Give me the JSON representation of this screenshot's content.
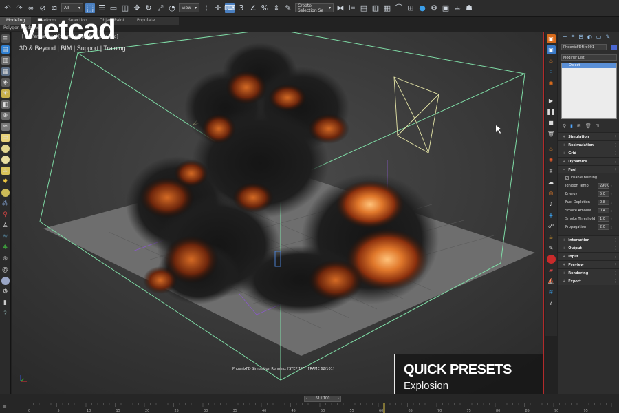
{
  "toolbar": {
    "filter_value": "All",
    "view_value": "View",
    "selection_set_placeholder": "Create Selection Se"
  },
  "ribbon": {
    "tabs": [
      "Modeling",
      "Freeform",
      "Selection",
      "Object Paint",
      "Populate"
    ],
    "sub_label": "Polygon Modeling"
  },
  "branding": {
    "logo_text": "vietcad",
    "tagline": "3D & Beyond | BIM | Support | Training"
  },
  "viewport": {
    "label": "[+] [Perspective] [Standard] [Default Shading]",
    "sim_status": "PhoenixFD Simulation Running: [STEP 1/7] [FRAME 62/101]"
  },
  "command_panel": {
    "tab_icons": [
      "plus-icon",
      "modify-icon",
      "hierarchy-icon",
      "motion-icon",
      "display-icon",
      "utilities-icon"
    ],
    "object_name": "PhoenixFDFire001",
    "object_color": "#4a66d0",
    "modifier_list_label": "Modifier List",
    "stack_item": "Object",
    "rollouts_top": [
      "Simulation",
      "Resimulation",
      "Grid",
      "Dynamics",
      "Fuel"
    ],
    "enable_burning": "Enable Burning",
    "params": [
      {
        "label": "Ignition Temp.",
        "value": "290.0"
      },
      {
        "label": "Energy",
        "value": "5.0"
      },
      {
        "label": "Fuel Depletion",
        "value": "0.8"
      },
      {
        "label": "Smoke Amount",
        "value": "0.4"
      },
      {
        "label": "Smoke Threshold",
        "value": "1.0"
      },
      {
        "label": "Propagation",
        "value": "2.0"
      }
    ],
    "rollouts_bottom": [
      "Interaction",
      "Output",
      "Input",
      "Preview",
      "Rendering",
      "Export"
    ]
  },
  "timeline": {
    "frame_display": "61 / 100",
    "ticks": [
      "0",
      "5",
      "10",
      "15",
      "20",
      "25",
      "30",
      "35",
      "40",
      "45",
      "50",
      "55",
      "60",
      "65",
      "70",
      "75",
      "80",
      "85",
      "90",
      "95",
      "100"
    ]
  },
  "overlay": {
    "title": "QUICK PRESETS",
    "subtitle": "Explosion"
  }
}
